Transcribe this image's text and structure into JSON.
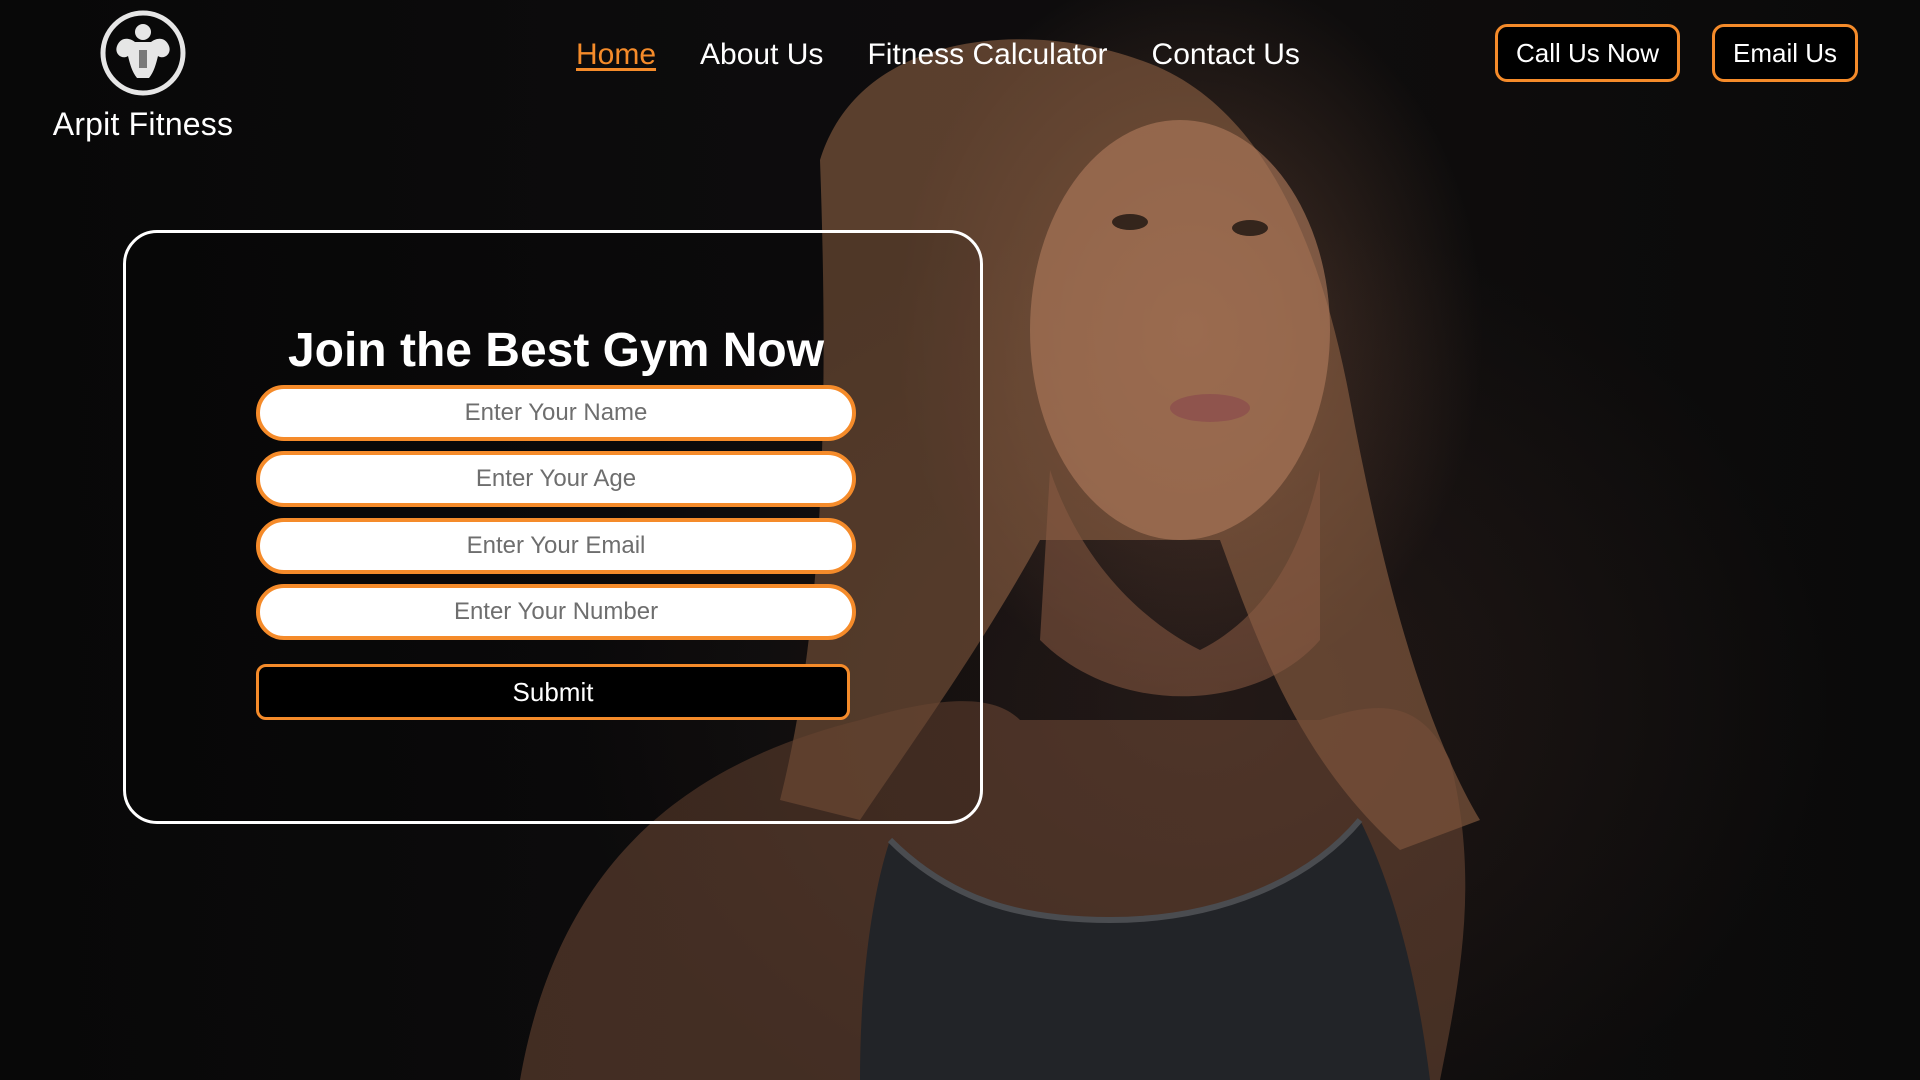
{
  "brand": {
    "name": "Arpit Fitness",
    "logo_icon": "muscle-man-icon"
  },
  "nav": {
    "items": [
      {
        "label": "Home",
        "active": true
      },
      {
        "label": "About Us",
        "active": false
      },
      {
        "label": "Fitness Calculator",
        "active": false
      },
      {
        "label": "Contact Us",
        "active": false
      }
    ]
  },
  "cta": {
    "call_label": "Call Us Now",
    "email_label": "Email Us"
  },
  "form": {
    "title": "Join the Best Gym Now",
    "fields": [
      {
        "placeholder": "Enter Your Name",
        "value": ""
      },
      {
        "placeholder": "Enter Your Age",
        "value": ""
      },
      {
        "placeholder": "Enter Your Email",
        "value": ""
      },
      {
        "placeholder": "Enter Your Number",
        "value": ""
      }
    ],
    "submit_label": "Submit"
  },
  "colors": {
    "accent": "#f58b2a",
    "background": "#0c0b0c",
    "text": "#ffffff",
    "placeholder": "#6e6e6e"
  }
}
